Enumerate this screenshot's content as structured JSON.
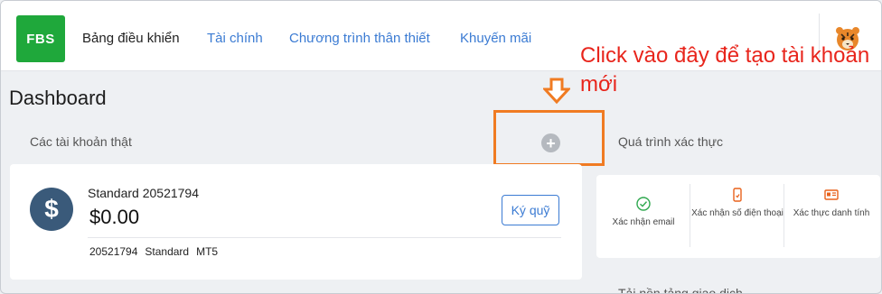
{
  "brand": {
    "logo_text": "FBS",
    "logo_color": "#1fa83b"
  },
  "nav": {
    "items": [
      {
        "label": "Bảng điều khiển",
        "active": true
      },
      {
        "label": "Tài chính",
        "active": false
      },
      {
        "label": "Chương trình thân thiết",
        "active": false
      },
      {
        "label": "Khuyến mãi",
        "active": false
      }
    ]
  },
  "page": {
    "title": "Dashboard"
  },
  "real_accounts": {
    "section_label": "Các tài khoản thật",
    "add_button_symbol": "+",
    "account": {
      "icon_symbol": "$",
      "name": "Standard 20521794",
      "balance": "$0.00",
      "deposit_label": "Ký quỹ",
      "meta": [
        "20521794",
        "Standard",
        "MT5"
      ]
    }
  },
  "verification": {
    "section_label": "Quá trình xác thực",
    "steps": [
      {
        "label": "Xác nhận email",
        "icon": "check-circle-icon"
      },
      {
        "label": "Xác nhận số điện thoại",
        "icon": "phone-icon"
      },
      {
        "label": "Xác thực danh tính",
        "icon": "id-card-icon"
      }
    ]
  },
  "bottom_section_label": "Tải nền tảng giao dịch",
  "annotation": {
    "text": "Click vào đây để tạo tài khoản mới",
    "color": "#e8251c",
    "highlight_color": "#f07b22"
  },
  "colors": {
    "accent": "#3b7bd3",
    "verify_green": "#2fa84f",
    "verify_orange": "#e8621c"
  }
}
